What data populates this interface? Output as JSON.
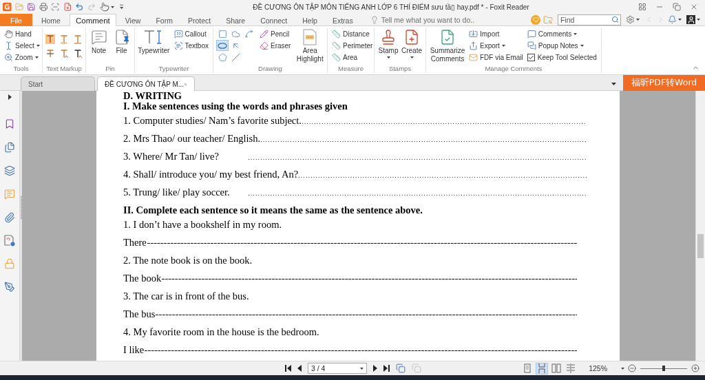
{
  "window": {
    "title": "ĐỀ CƯƠNG ÔN TẬP MÔN TIẾNG ANH LỚP 6 THÍ ĐIỂM sưu tầ▯ hay.pdf * - Foxit Reader"
  },
  "quick_access": {
    "redo_disabled": true
  },
  "menu_tabs": [
    {
      "label": "File",
      "kind": "file",
      "selected": false
    },
    {
      "label": "Home",
      "kind": "tab",
      "selected": false
    },
    {
      "label": "Comment",
      "kind": "tab",
      "selected": true
    },
    {
      "label": "View",
      "kind": "tab",
      "selected": false
    },
    {
      "label": "Form",
      "kind": "tab",
      "selected": false
    },
    {
      "label": "Protect",
      "kind": "tab",
      "selected": false
    },
    {
      "label": "Share",
      "kind": "tab",
      "selected": false
    },
    {
      "label": "Connect",
      "kind": "tab",
      "selected": false
    },
    {
      "label": "Help",
      "kind": "tab",
      "selected": false
    },
    {
      "label": "Extras",
      "kind": "tab",
      "selected": false
    }
  ],
  "tell_me": {
    "placeholder": "Tell me what you want to do.."
  },
  "find": {
    "placeholder": "Find"
  },
  "history": {
    "back_disabled": true,
    "forward_disabled": true
  },
  "ribbon": {
    "tools": {
      "label": "Tools",
      "items": [
        {
          "label": "Hand",
          "dropdown": false
        },
        {
          "label": "Select",
          "dropdown": true
        },
        {
          "label": "Zoom",
          "dropdown": true
        }
      ]
    },
    "text_markup": {
      "label": "Text Markup"
    },
    "pin": {
      "label": "Pin",
      "items": [
        {
          "label": "Note"
        },
        {
          "label": "File"
        }
      ]
    },
    "typewriter": {
      "label": "Typewriter",
      "items": [
        {
          "label": "Typewriter",
          "kind": "large"
        },
        {
          "label": "Callout",
          "kind": "small"
        },
        {
          "label": "Textbox",
          "kind": "small"
        }
      ]
    },
    "drawing": {
      "label": "Drawing",
      "shapes": [
        {
          "selected": false
        },
        {
          "selected": false
        },
        {
          "selected": false
        },
        {
          "selected": true
        },
        {
          "selected": false
        },
        {
          "selected": false
        },
        {
          "selected": false
        }
      ],
      "items": [
        {
          "label": "Pencil",
          "kind": "small"
        },
        {
          "label": "Eraser",
          "kind": "small"
        },
        {
          "label": "Area Highlight",
          "kind": "large"
        }
      ]
    },
    "measure": {
      "label": "Measure",
      "items": [
        {
          "label": "Distance"
        },
        {
          "label": "Perimeter"
        },
        {
          "label": "Area"
        }
      ]
    },
    "stamps": {
      "label": "Stamps",
      "items": [
        {
          "label": "Stamp",
          "dropdown": true
        },
        {
          "label": "Create",
          "dropdown": true
        }
      ]
    },
    "manage_comments": {
      "label": "Manage Comments",
      "items": [
        {
          "label": "Summarize Comments",
          "kind": "large",
          "dropdown": false
        },
        {
          "label": "Import",
          "kind": "small",
          "dropdown": false
        },
        {
          "label": "Export",
          "kind": "small",
          "dropdown": true
        },
        {
          "label": "FDF via Email",
          "kind": "small",
          "dropdown": false
        },
        {
          "label": "Comments",
          "kind": "small",
          "dropdown": true
        },
        {
          "label": "Popup Notes",
          "kind": "small",
          "dropdown": true
        },
        {
          "label": "Keep Tool Selected",
          "kind": "checkbox",
          "checked": true
        }
      ]
    }
  },
  "doc_tabs": [
    {
      "label": "Start",
      "selected": false,
      "closable": false
    },
    {
      "label": "ĐỀ CƯƠNG ÔN TẬP M...",
      "selected": true,
      "closable": true
    }
  ],
  "promo": {
    "label": "福昕PDF转Word"
  },
  "document": {
    "lines": [
      {
        "kind": "heading",
        "text": "D. WRITING"
      },
      {
        "kind": "heading",
        "text": "I. Make sentences using the words and phrases given"
      },
      {
        "kind": "dotted",
        "text": "1. Computer studies/ Nam’s favorite subject."
      },
      {
        "kind": "dotted",
        "text": "2. Mrs Thao/ our teacher/ English."
      },
      {
        "kind": "dotted",
        "text": "3. Where/ Mr Tan/ live?"
      },
      {
        "kind": "dotted",
        "text": "4. Shall/ introduce you/ my best friend, An?"
      },
      {
        "kind": "dotted",
        "text": "5. Trung/ like/ play soccer."
      },
      {
        "kind": "heading",
        "text": "II. Complete each sentence so it means the same as the sentence above."
      },
      {
        "kind": "sentence",
        "text": "1. I don’t have a bookshelf in my room."
      },
      {
        "kind": "dashed",
        "text": "There"
      },
      {
        "kind": "sentence",
        "text": "2. The note book is on the book."
      },
      {
        "kind": "dashed",
        "text": "The book"
      },
      {
        "kind": "sentence",
        "text": "3. The car is in front of the bus."
      },
      {
        "kind": "dashed",
        "text": "The bus"
      },
      {
        "kind": "sentence",
        "text": "4. My favorite room in the house is the bedroom."
      },
      {
        "kind": "dashed",
        "text": "I like"
      }
    ]
  },
  "status_bar": {
    "page": {
      "value": "3 / 4"
    },
    "page_tools": [
      {
        "disabled": false
      },
      {
        "disabled": true
      }
    ],
    "view_modes": [
      {
        "selected": false
      },
      {
        "selected": true
      },
      {
        "selected": false
      },
      {
        "selected": false
      }
    ],
    "zoom": {
      "value": "125%",
      "level": 0.5
    }
  }
}
